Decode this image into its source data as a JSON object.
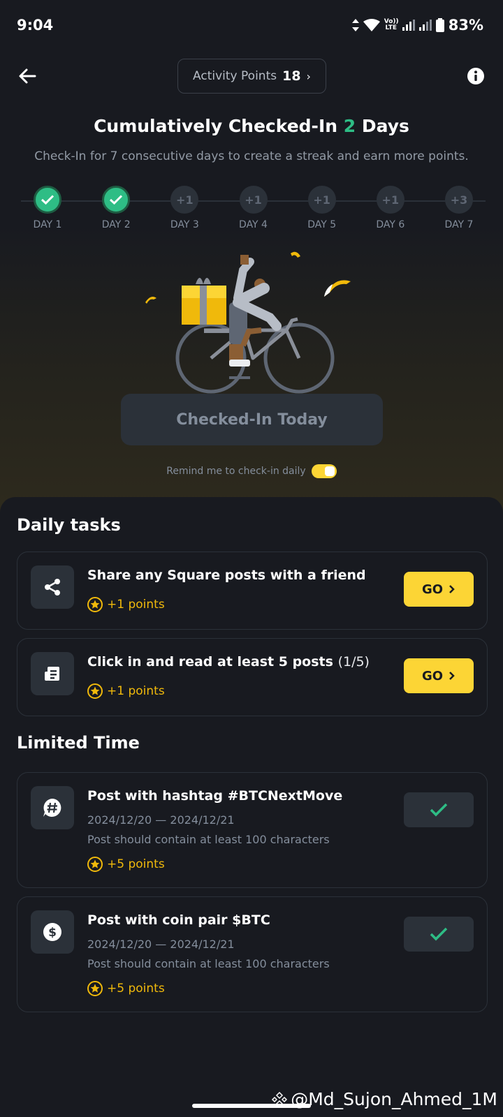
{
  "status_bar": {
    "time": "9:04",
    "volte": "Vo)) LTE",
    "battery": "83%"
  },
  "header": {
    "points_label": "Activity Points",
    "points_value": "18",
    "points_chevron": "›"
  },
  "checkin": {
    "headline_prefix": "Cumulatively Checked-In",
    "days_count": "2",
    "headline_suffix": "Days",
    "subtitle": "Check-In for 7 consecutive days to create a streak and earn more points.",
    "days": [
      {
        "label": "DAY 1",
        "done": true,
        "reward": ""
      },
      {
        "label": "DAY 2",
        "done": true,
        "reward": ""
      },
      {
        "label": "DAY 3",
        "done": false,
        "reward": "+1"
      },
      {
        "label": "DAY 4",
        "done": false,
        "reward": "+1"
      },
      {
        "label": "DAY 5",
        "done": false,
        "reward": "+1"
      },
      {
        "label": "DAY 6",
        "done": false,
        "reward": "+1"
      },
      {
        "label": "DAY 7",
        "done": false,
        "reward": "+3"
      }
    ],
    "button_label": "Checked-In Today",
    "remind_label": "Remind me to check-in daily",
    "remind_on": true
  },
  "daily_tasks": {
    "title": "Daily tasks",
    "items": [
      {
        "title": "Share any Square posts with a friend",
        "progress": "",
        "reward": "+1 points",
        "button": "GO",
        "icon": "share-icon"
      },
      {
        "title": "Click in and read at least 5 posts",
        "progress": "(1/5)",
        "reward": "+1 points",
        "button": "GO",
        "icon": "article-icon"
      }
    ]
  },
  "limited_time": {
    "title": "Limited Time",
    "items": [
      {
        "title": "Post with hashtag #BTCNextMove",
        "dates": "2024/12/20 — 2024/12/21",
        "note": "Post should contain at least 100 characters",
        "reward": "+5 points",
        "icon": "hashtag-icon",
        "completed": true
      },
      {
        "title": "Post with coin pair $BTC",
        "dates": "2024/12/20 — 2024/12/21",
        "note": "Post should contain at least 100 characters",
        "reward": "+5 points",
        "icon": "dollar-coin-icon",
        "completed": true
      }
    ]
  },
  "watermark": "@Md_Sujon_Ahmed_1M",
  "colors": {
    "accent": "#fcd535",
    "success": "#2ebd85",
    "background": "#181a20",
    "surface": "#2b3139",
    "reward": "#f0b90b"
  }
}
